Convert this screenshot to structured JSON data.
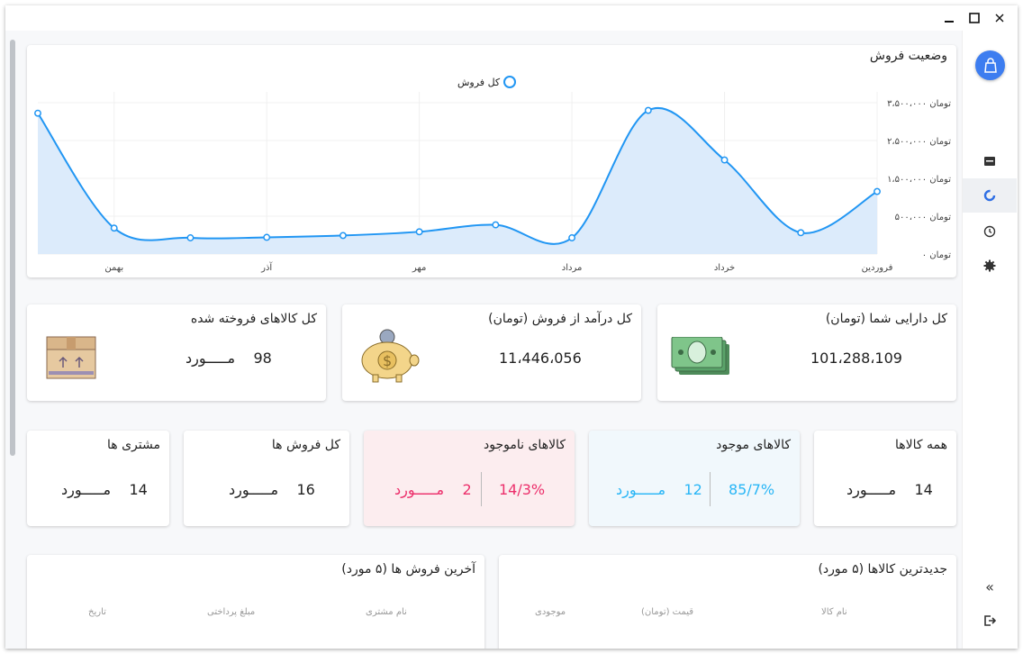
{
  "window": {
    "minimize_icon": "minimize-icon",
    "maximize_icon": "maximize-icon",
    "close_icon": "close-icon"
  },
  "sidebar": {
    "items": [
      {
        "name": "inbox-icon"
      },
      {
        "name": "refresh-icon",
        "active": true
      },
      {
        "name": "history-icon"
      },
      {
        "name": "gear-icon"
      }
    ],
    "collapse_label": "«",
    "logout_icon": "logout-icon"
  },
  "sales_chart": {
    "title": "وضعیت فروش",
    "legend": "کل فروش"
  },
  "chart_data": {
    "type": "area",
    "title": "وضعیت فروش",
    "categories": [
      "فروردین",
      "",
      "خرداد",
      "",
      "مرداد",
      "",
      "مهر",
      "",
      "آذر",
      "",
      "بهمن",
      ""
    ],
    "x_tick_labels": [
      "فروردین",
      "خرداد",
      "مرداد",
      "مهر",
      "آذر",
      "بهمن"
    ],
    "y_tick_labels": [
      "۰ تومان",
      "۵۰۰،۰۰۰ تومان",
      "۱،۵۰۰،۰۰۰ تومان",
      "۲،۵۰۰،۰۰۰ تومان",
      "۳،۵۰۰،۰۰۰ تومان"
    ],
    "ylim": [
      0,
      3500000
    ],
    "series": [
      {
        "name": "کل فروش",
        "values": [
          1350000,
          460000,
          2030000,
          3100000,
          350000,
          630000,
          480000,
          400000,
          360000,
          350000,
          560000,
          3040000
        ]
      }
    ],
    "color": "#2196f3",
    "fill": "#dcebfb"
  },
  "stats": {
    "assets": {
      "title": "کل دارایی شما (تومان)",
      "value": "101،288،109"
    },
    "revenue": {
      "title": "کل درآمد از فروش (تومان)",
      "value": "11،446،056"
    },
    "sold": {
      "title": "کل کالاهای فروخته شده",
      "value": "98",
      "unit": "مـــــورد"
    }
  },
  "counts": {
    "all": {
      "title": "همه کالاها",
      "value": "14",
      "unit": "مـــــورد"
    },
    "available": {
      "title": "کالاهای موجود",
      "value": "12",
      "unit": "مـــــورد",
      "percent": "85/7%",
      "color": "#29b6f6"
    },
    "unavailable": {
      "title": "کالاهای ناموجود",
      "value": "2",
      "unit": "مـــــورد",
      "percent": "14/3%",
      "color": "#ec2f6b"
    },
    "sales": {
      "title": "کل فروش ها",
      "value": "16",
      "unit": "مـــــورد"
    },
    "customers": {
      "title": "مشتری ها",
      "value": "14",
      "unit": "مـــــورد"
    }
  },
  "newest_products": {
    "title": "جدیدترین کالاها (۵ مورد)",
    "columns": [
      "نام کالا",
      "قیمت (تومان)",
      "موجودی"
    ]
  },
  "latest_sales": {
    "title": "آخرین فروش ها (۵ مورد)",
    "columns": [
      "نام مشتری",
      "مبلغ پرداختی",
      "تاریخ"
    ]
  }
}
